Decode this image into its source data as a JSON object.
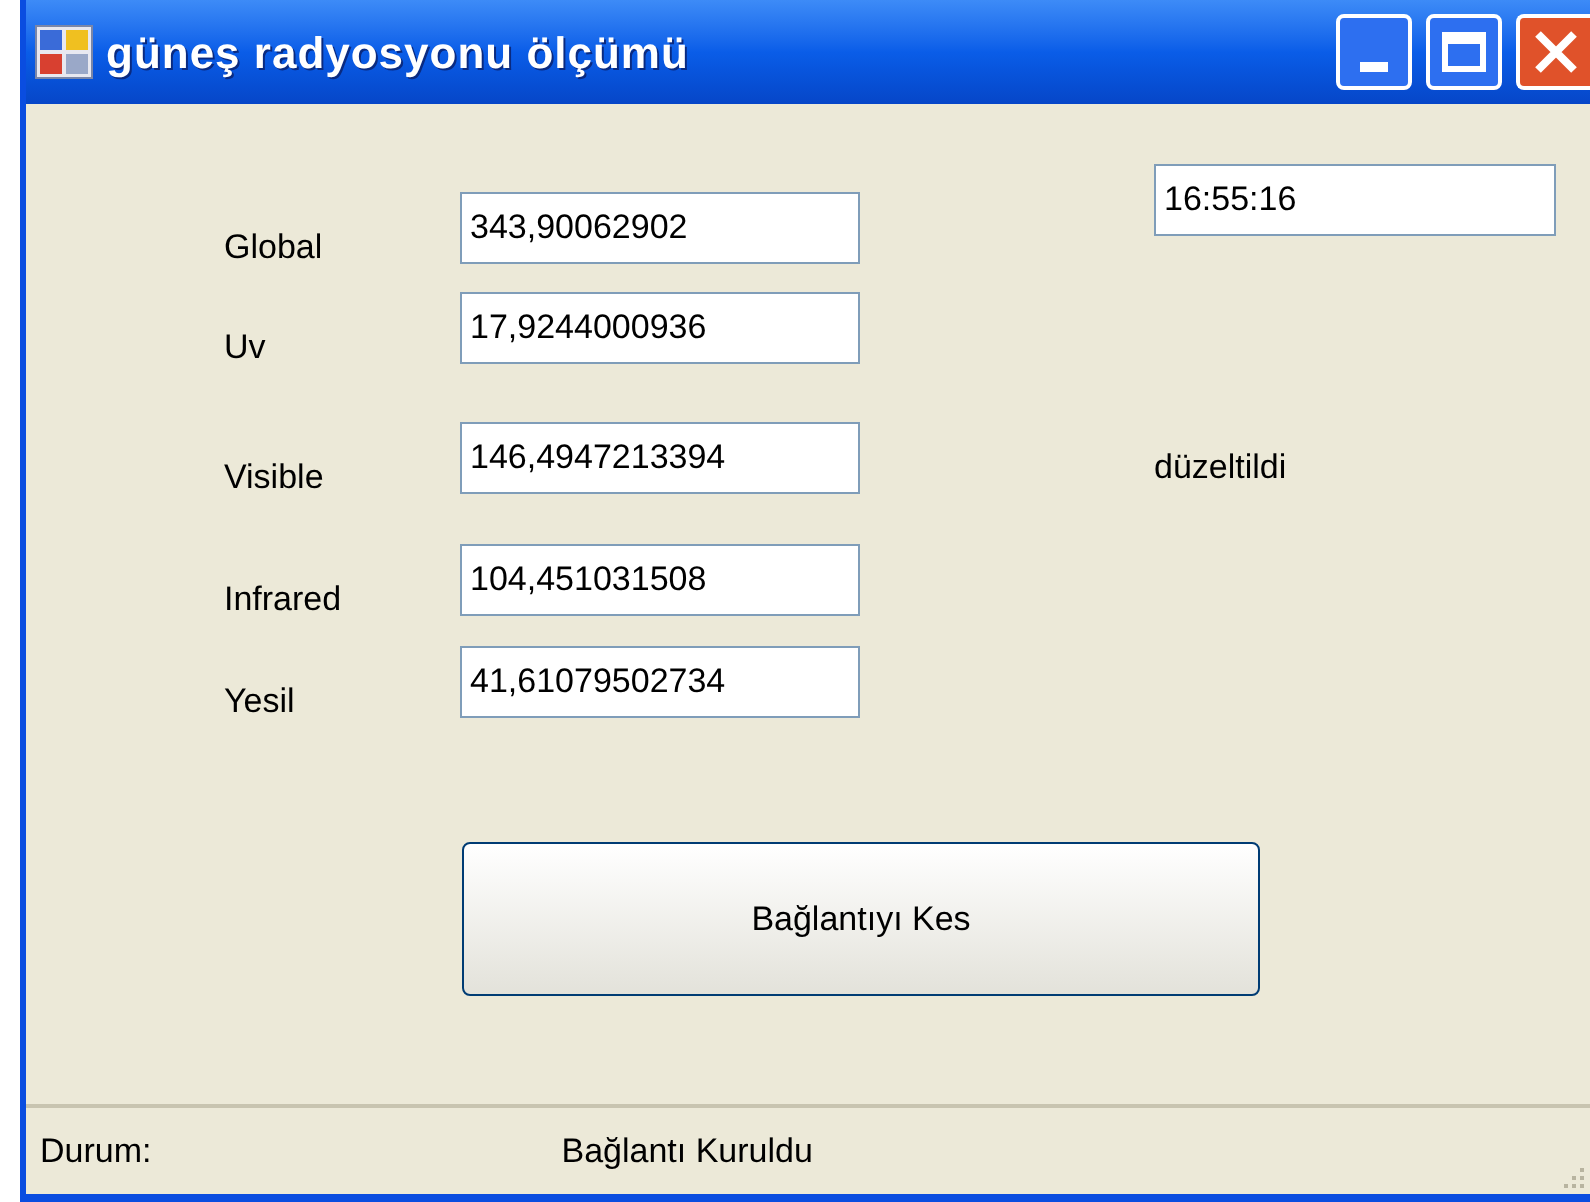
{
  "window": {
    "title": "güneş radyosyonu ölçümü"
  },
  "readings": [
    {
      "label": "Global",
      "value": "343,90062902"
    },
    {
      "label": "Uv",
      "value": "17,9244000936"
    },
    {
      "label": "Visible",
      "value": "146,4947213394"
    },
    {
      "label": "Infrared",
      "value": "104,451031508"
    },
    {
      "label": "Yesil",
      "value": "41,61079502734"
    }
  ],
  "time_field": {
    "value": "16:55:16"
  },
  "note": "düzeltildi",
  "button": {
    "label": "Bağlantıyı Kes"
  },
  "status_bar": {
    "label": "Durum:",
    "text": "Bağlantı Kuruldu"
  }
}
